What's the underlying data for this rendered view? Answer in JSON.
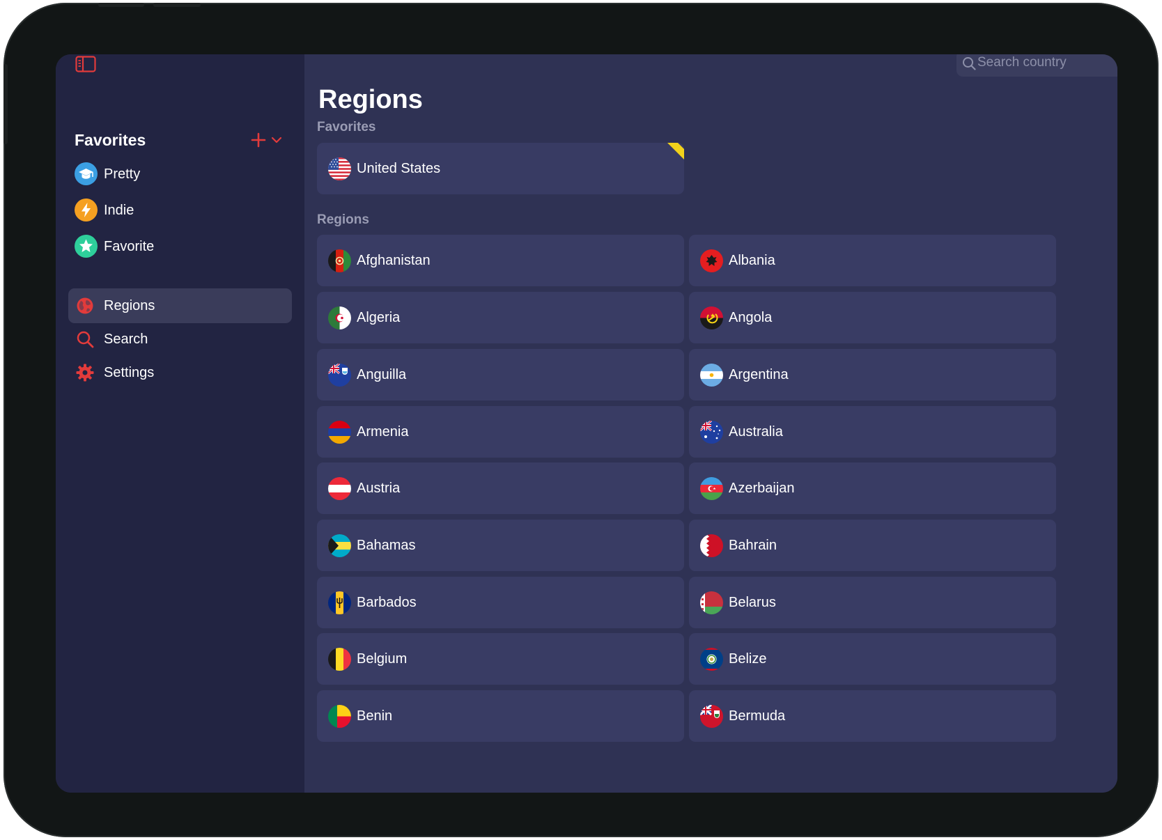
{
  "sidebar": {
    "favorites_title": "Favorites",
    "favorites": [
      {
        "label": "Pretty",
        "icon": "graduation-cap-icon",
        "color": "#3b9fe3"
      },
      {
        "label": "Indie",
        "icon": "bolt-icon",
        "color": "#f5a021"
      },
      {
        "label": "Favorite",
        "icon": "star-icon",
        "color": "#2ecf9b"
      }
    ],
    "nav": [
      {
        "label": "Regions",
        "icon": "globe-icon",
        "active": true
      },
      {
        "label": "Search",
        "icon": "search-icon",
        "active": false
      },
      {
        "label": "Settings",
        "icon": "gear-icon",
        "active": false
      }
    ],
    "accent": "#e23b3b"
  },
  "main": {
    "search_placeholder": "Search country",
    "title": "Regions",
    "favorites_label": "Favorites",
    "regions_label": "Regions",
    "favorite_countries": [
      {
        "name": "United States",
        "flag": "us-flag-icon"
      }
    ],
    "regions": [
      {
        "name": "Afghanistan",
        "flag": "afghanistan-flag-icon"
      },
      {
        "name": "Albania",
        "flag": "albania-flag-icon"
      },
      {
        "name": "Algeria",
        "flag": "algeria-flag-icon"
      },
      {
        "name": "Angola",
        "flag": "angola-flag-icon"
      },
      {
        "name": "Anguilla",
        "flag": "anguilla-flag-icon"
      },
      {
        "name": "Argentina",
        "flag": "argentina-flag-icon"
      },
      {
        "name": "Armenia",
        "flag": "armenia-flag-icon"
      },
      {
        "name": "Australia",
        "flag": "australia-flag-icon"
      },
      {
        "name": "Austria",
        "flag": "austria-flag-icon"
      },
      {
        "name": "Azerbaijan",
        "flag": "azerbaijan-flag-icon"
      },
      {
        "name": "Bahamas",
        "flag": "bahamas-flag-icon"
      },
      {
        "name": "Bahrain",
        "flag": "bahrain-flag-icon"
      },
      {
        "name": "Barbados",
        "flag": "barbados-flag-icon"
      },
      {
        "name": "Belarus",
        "flag": "belarus-flag-icon"
      },
      {
        "name": "Belgium",
        "flag": "belgium-flag-icon"
      },
      {
        "name": "Belize",
        "flag": "belize-flag-icon"
      },
      {
        "name": "Benin",
        "flag": "benin-flag-icon"
      },
      {
        "name": "Bermuda",
        "flag": "bermuda-flag-icon"
      }
    ]
  }
}
